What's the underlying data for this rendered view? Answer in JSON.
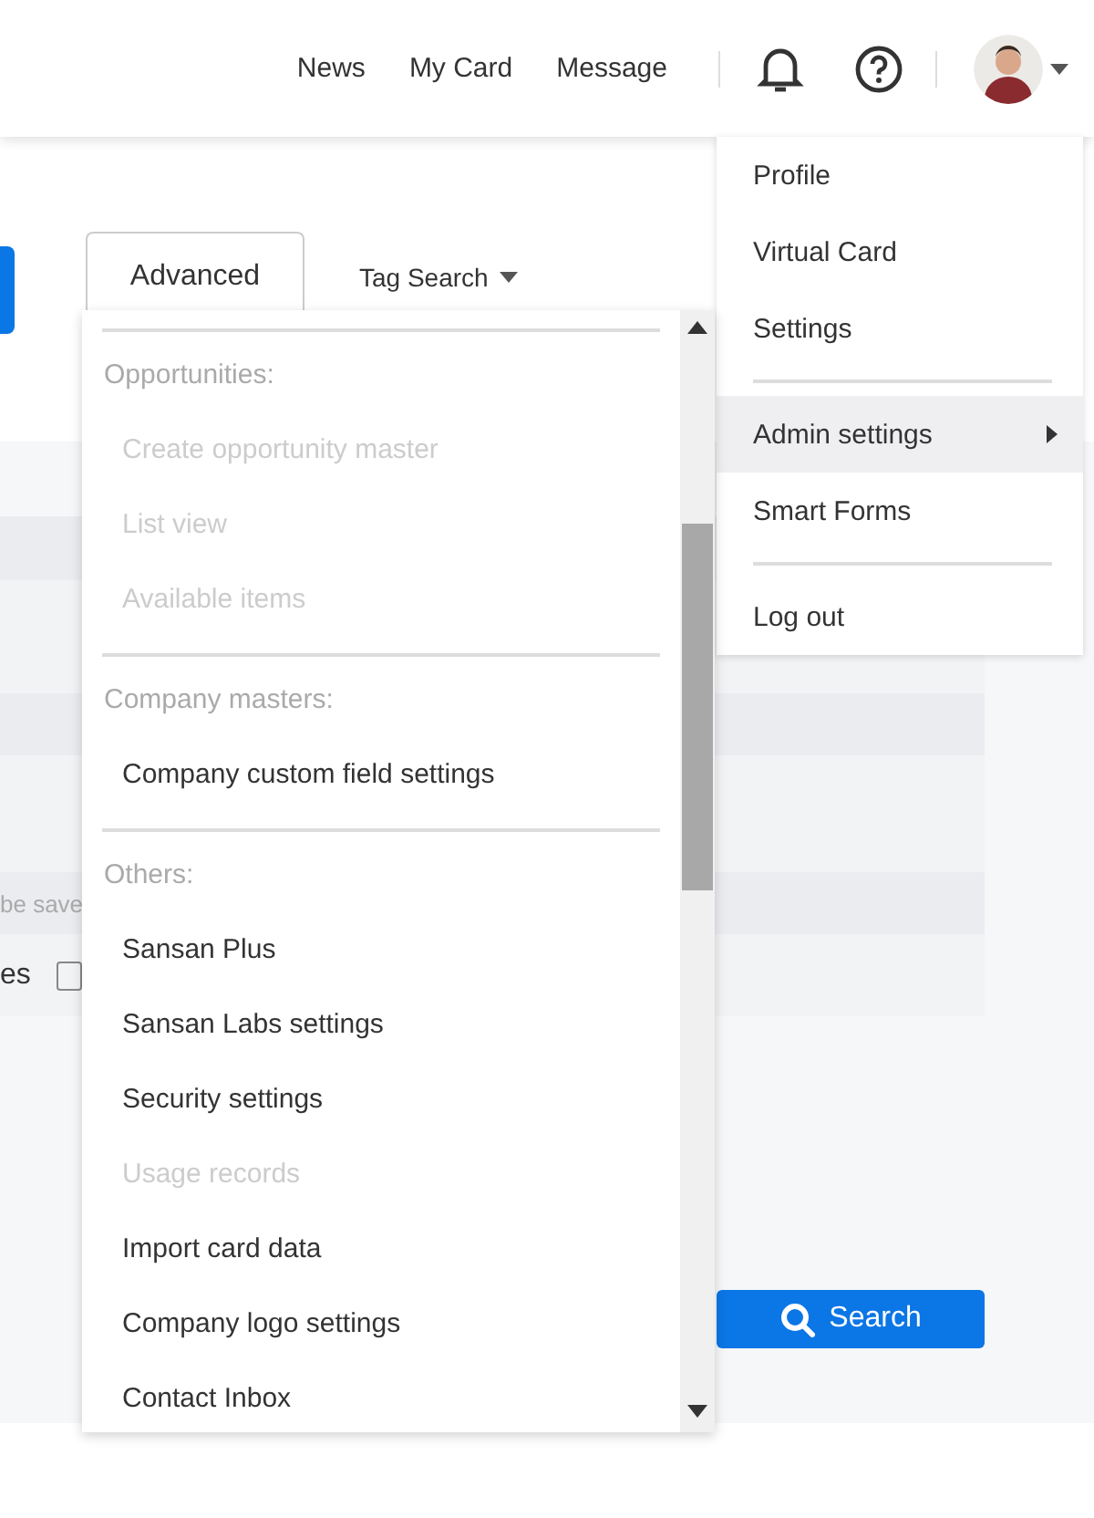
{
  "header": {
    "nav_links": [
      "News",
      "My Card",
      "Message"
    ]
  },
  "tabs": [
    {
      "label": "Advanced",
      "selected": true
    },
    {
      "label": "Tag Search",
      "selected": false
    }
  ],
  "form": {
    "hint_fragment": "be save",
    "option_fragment": "es",
    "option_checked": false,
    "search_button": "Search"
  },
  "admin_menu": [
    {
      "kind": "divider"
    },
    {
      "kind": "heading",
      "label": "Opportunities:"
    },
    {
      "kind": "item",
      "label": "Create opportunity master",
      "disabled": true
    },
    {
      "kind": "item",
      "label": "List view",
      "disabled": true
    },
    {
      "kind": "item",
      "label": "Available items",
      "disabled": true
    },
    {
      "kind": "divider"
    },
    {
      "kind": "heading",
      "label": "Company masters:"
    },
    {
      "kind": "item",
      "label": "Company custom field settings",
      "disabled": false
    },
    {
      "kind": "divider"
    },
    {
      "kind": "heading",
      "label": "Others:"
    },
    {
      "kind": "item",
      "label": "Sansan Plus",
      "disabled": false
    },
    {
      "kind": "item",
      "label": "Sansan Labs settings",
      "disabled": false
    },
    {
      "kind": "item",
      "label": "Security settings",
      "disabled": false
    },
    {
      "kind": "item",
      "label": "Usage records",
      "disabled": true
    },
    {
      "kind": "item",
      "label": "Import card data",
      "disabled": false
    },
    {
      "kind": "item",
      "label": "Company logo settings",
      "disabled": false
    },
    {
      "kind": "item",
      "label": "Contact Inbox",
      "disabled": false
    }
  ],
  "user_menu": [
    {
      "kind": "item",
      "label": "Profile",
      "selected": false,
      "submenu": false
    },
    {
      "kind": "item",
      "label": "Virtual Card",
      "selected": false,
      "submenu": false
    },
    {
      "kind": "item",
      "label": "Settings",
      "selected": false,
      "submenu": false
    },
    {
      "kind": "divider"
    },
    {
      "kind": "item",
      "label": "Admin settings",
      "selected": true,
      "submenu": true
    },
    {
      "kind": "item",
      "label": "Smart Forms",
      "selected": false,
      "submenu": false
    },
    {
      "kind": "divider"
    },
    {
      "kind": "item",
      "label": "Log out",
      "selected": false,
      "submenu": false
    }
  ]
}
